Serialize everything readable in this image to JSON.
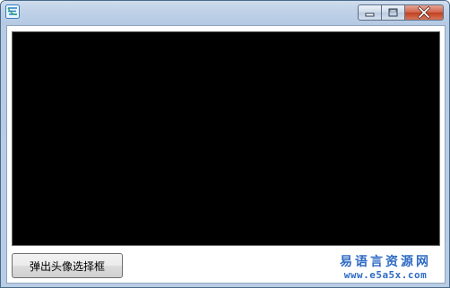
{
  "window": {
    "title": "",
    "icon": "app-logo-icon",
    "controls": {
      "minimize_icon": "minimize-icon",
      "maximize_icon": "maximize-icon",
      "close_icon": "close-icon"
    }
  },
  "main": {
    "viewport_color": "#000000",
    "select_avatar_button": "弹出头像选择框"
  },
  "watermark": {
    "title": "易语言资源网",
    "url": "www.e5a5x.com",
    "color": "#2f6bc4"
  }
}
